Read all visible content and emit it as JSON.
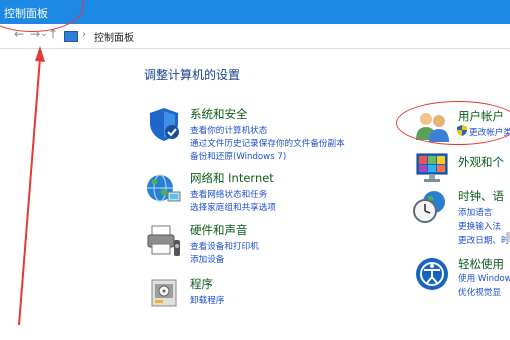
{
  "window": {
    "title": "控制面板"
  },
  "nav": {
    "back": "←",
    "forward": "→",
    "recent": "⌄",
    "up": "↑",
    "sep": "›",
    "breadcrumb": "控制面板"
  },
  "main": {
    "title": "调整计算机的设置",
    "categories": [
      {
        "name": "系统和安全",
        "links": [
          "查看你的计算机状态",
          "通过文件历史记录保存你的文件备份副本",
          "备份和还原(Windows 7)"
        ]
      },
      {
        "name": "网络和 Internet",
        "links": [
          "查看网络状态和任务",
          "选择家庭组和共享选项"
        ]
      },
      {
        "name": "硬件和声音",
        "links": [
          "查看设备和打印机",
          "添加设备"
        ]
      },
      {
        "name": "程序",
        "links": [
          "卸载程序"
        ]
      },
      {
        "name": "用户帐户",
        "links": [
          "更改帐户类"
        ]
      },
      {
        "name": "外观和个",
        "links": []
      },
      {
        "name": "时钟、语",
        "links": [
          "添加语言",
          "更换输入法",
          "更改日期、时"
        ]
      },
      {
        "name": "轻松使用",
        "links": [
          "使用 Window",
          "优化视觉显"
        ]
      }
    ]
  },
  "colors": {
    "titlebar": "#1e88e5",
    "category_heading": "#0c5d1a",
    "link": "#1f4fd0",
    "annotation": "#e53935"
  }
}
